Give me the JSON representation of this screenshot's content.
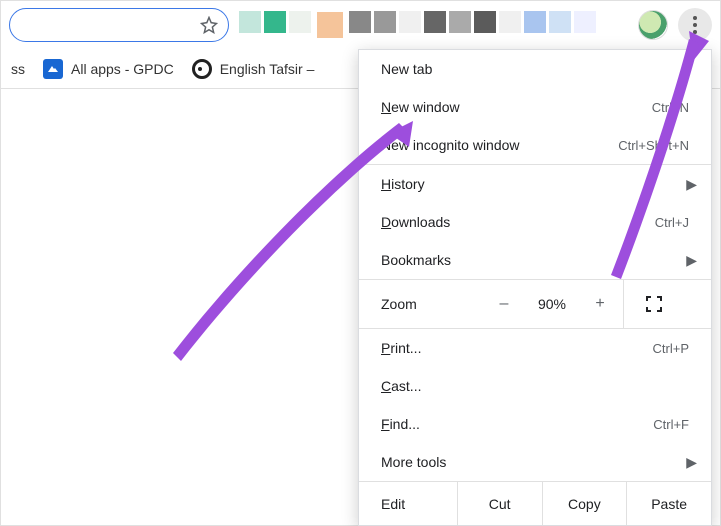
{
  "toolbar": {
    "profile_avatar": "avatar",
    "menu_icon": "more-vert-icon"
  },
  "bookmark_bar": {
    "items": [
      {
        "label": "ss",
        "icon": "cut-label"
      },
      {
        "label": "All apps - GPDC",
        "icon": "folder-blue-icon"
      },
      {
        "label": "English Tafsir –",
        "icon": "globe-icon"
      }
    ]
  },
  "menu": {
    "group1": [
      {
        "label": "New tab",
        "shortcut": "",
        "arrow": false
      },
      {
        "label": "New window",
        "shortcut": "Ctrl+N",
        "arrow": false,
        "underline_first": true
      },
      {
        "label": "New incognito window",
        "shortcut": "Ctrl+Shift+N",
        "arrow": false
      }
    ],
    "group2": [
      {
        "label": "History",
        "shortcut": "",
        "arrow": true,
        "underline_first": true
      },
      {
        "label": "Downloads",
        "shortcut": "Ctrl+J",
        "arrow": false,
        "underline_first": true
      },
      {
        "label": "Bookmarks",
        "shortcut": "",
        "arrow": true
      }
    ],
    "zoom": {
      "label": "Zoom",
      "minus": "–",
      "pct": "90%",
      "plus": "+",
      "fullscreen_icon": "fullscreen-icon"
    },
    "group3": [
      {
        "label": "Print...",
        "shortcut": "Ctrl+P",
        "underline_first": true
      },
      {
        "label": "Cast...",
        "shortcut": "",
        "underline_first": true
      },
      {
        "label": "Find...",
        "shortcut": "Ctrl+F",
        "underline_first": true
      },
      {
        "label": "More tools",
        "shortcut": "",
        "arrow": true
      }
    ],
    "edit": {
      "label": "Edit",
      "cut": "Cut",
      "copy": "Copy",
      "paste": "Paste"
    }
  }
}
